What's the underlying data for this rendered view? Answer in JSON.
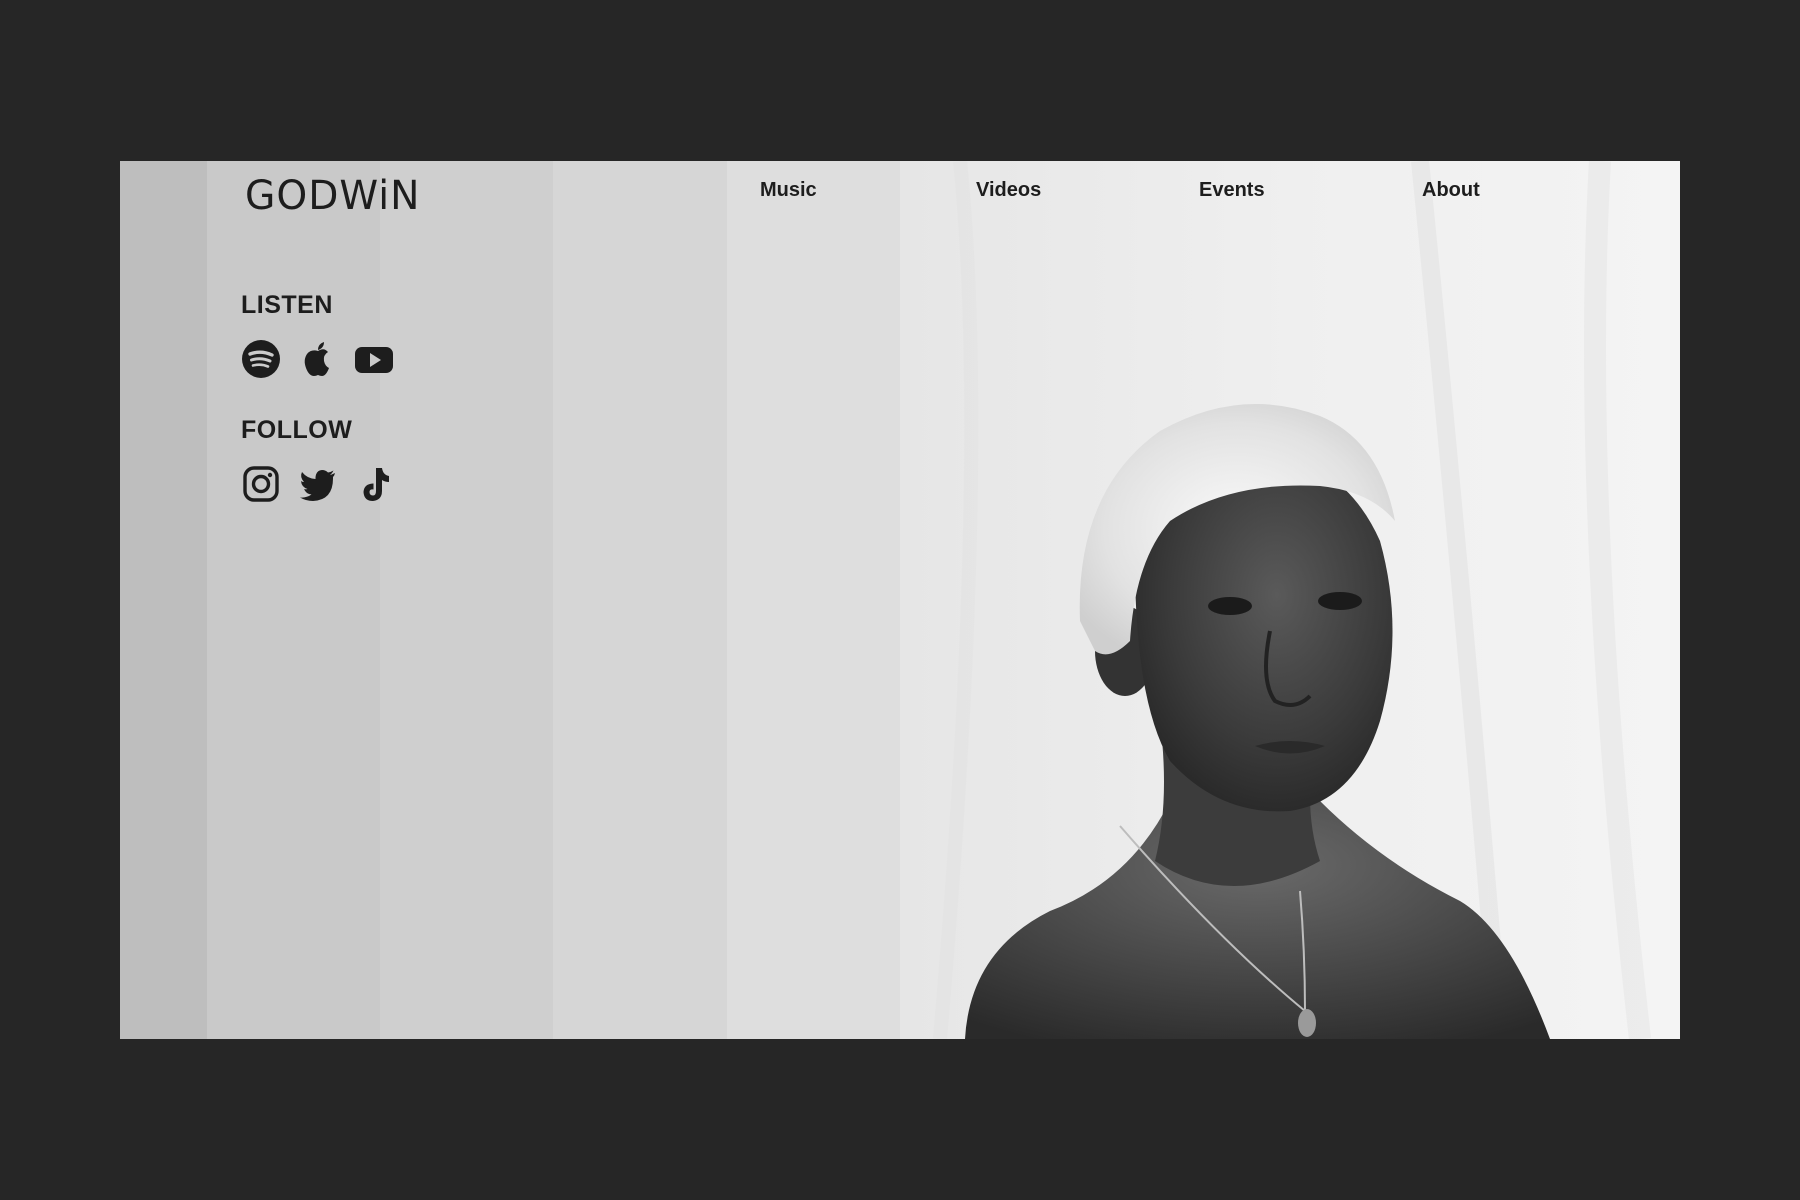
{
  "brand": {
    "logo_text": "GODWiN"
  },
  "nav": {
    "items": [
      {
        "label": "Music"
      },
      {
        "label": "Videos"
      },
      {
        "label": "Events"
      },
      {
        "label": "About"
      }
    ]
  },
  "sidebar": {
    "listen": {
      "label": "LISTEN",
      "icons": [
        "spotify-icon",
        "apple-icon",
        "youtube-icon"
      ]
    },
    "follow": {
      "label": "FOLLOW",
      "icons": [
        "instagram-icon",
        "twitter-icon",
        "tiktok-icon"
      ]
    }
  },
  "colors": {
    "background": "#262626",
    "text": "#1d1d1d",
    "stripes": [
      "#bebebe",
      "#c9c9c9",
      "#cfcfcf",
      "#d6d6d6",
      "#dedede"
    ],
    "photo_backdrop": "#f0f0f0"
  }
}
